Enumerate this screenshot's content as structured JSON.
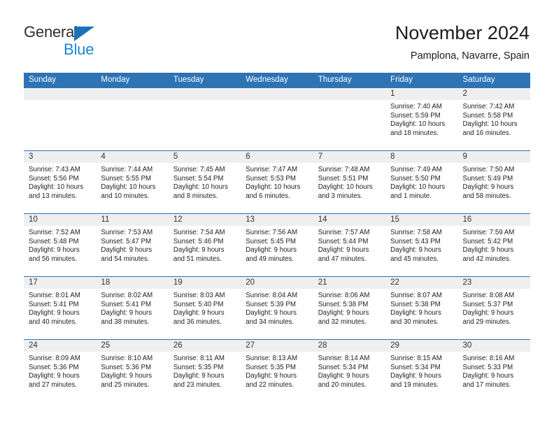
{
  "brand": {
    "name_part1": "General",
    "name_part2": "Blue",
    "logo_icon": "triangle-icon"
  },
  "header": {
    "title": "November 2024",
    "subtitle": "Pamplona, Navarre, Spain"
  },
  "colors": {
    "header_blue": "#2e73b4",
    "brand_blue": "#1b86d8",
    "logo_triangle_blue": "#1b72b8",
    "daynum_band": "#efefef",
    "text": "#1f1f1f"
  },
  "calendar": {
    "weekday_headers": [
      "Sunday",
      "Monday",
      "Tuesday",
      "Wednesday",
      "Thursday",
      "Friday",
      "Saturday"
    ],
    "weeks": [
      [
        {
          "day": "",
          "lines": []
        },
        {
          "day": "",
          "lines": []
        },
        {
          "day": "",
          "lines": []
        },
        {
          "day": "",
          "lines": []
        },
        {
          "day": "",
          "lines": []
        },
        {
          "day": "1",
          "lines": [
            "Sunrise: 7:40 AM",
            "Sunset: 5:59 PM",
            "Daylight: 10 hours",
            "and 18 minutes."
          ]
        },
        {
          "day": "2",
          "lines": [
            "Sunrise: 7:42 AM",
            "Sunset: 5:58 PM",
            "Daylight: 10 hours",
            "and 16 minutes."
          ]
        }
      ],
      [
        {
          "day": "3",
          "lines": [
            "Sunrise: 7:43 AM",
            "Sunset: 5:56 PM",
            "Daylight: 10 hours",
            "and 13 minutes."
          ]
        },
        {
          "day": "4",
          "lines": [
            "Sunrise: 7:44 AM",
            "Sunset: 5:55 PM",
            "Daylight: 10 hours",
            "and 10 minutes."
          ]
        },
        {
          "day": "5",
          "lines": [
            "Sunrise: 7:45 AM",
            "Sunset: 5:54 PM",
            "Daylight: 10 hours",
            "and 8 minutes."
          ]
        },
        {
          "day": "6",
          "lines": [
            "Sunrise: 7:47 AM",
            "Sunset: 5:53 PM",
            "Daylight: 10 hours",
            "and 6 minutes."
          ]
        },
        {
          "day": "7",
          "lines": [
            "Sunrise: 7:48 AM",
            "Sunset: 5:51 PM",
            "Daylight: 10 hours",
            "and 3 minutes."
          ]
        },
        {
          "day": "8",
          "lines": [
            "Sunrise: 7:49 AM",
            "Sunset: 5:50 PM",
            "Daylight: 10 hours",
            "and 1 minute."
          ]
        },
        {
          "day": "9",
          "lines": [
            "Sunrise: 7:50 AM",
            "Sunset: 5:49 PM",
            "Daylight: 9 hours",
            "and 58 minutes."
          ]
        }
      ],
      [
        {
          "day": "10",
          "lines": [
            "Sunrise: 7:52 AM",
            "Sunset: 5:48 PM",
            "Daylight: 9 hours",
            "and 56 minutes."
          ]
        },
        {
          "day": "11",
          "lines": [
            "Sunrise: 7:53 AM",
            "Sunset: 5:47 PM",
            "Daylight: 9 hours",
            "and 54 minutes."
          ]
        },
        {
          "day": "12",
          "lines": [
            "Sunrise: 7:54 AM",
            "Sunset: 5:46 PM",
            "Daylight: 9 hours",
            "and 51 minutes."
          ]
        },
        {
          "day": "13",
          "lines": [
            "Sunrise: 7:56 AM",
            "Sunset: 5:45 PM",
            "Daylight: 9 hours",
            "and 49 minutes."
          ]
        },
        {
          "day": "14",
          "lines": [
            "Sunrise: 7:57 AM",
            "Sunset: 5:44 PM",
            "Daylight: 9 hours",
            "and 47 minutes."
          ]
        },
        {
          "day": "15",
          "lines": [
            "Sunrise: 7:58 AM",
            "Sunset: 5:43 PM",
            "Daylight: 9 hours",
            "and 45 minutes."
          ]
        },
        {
          "day": "16",
          "lines": [
            "Sunrise: 7:59 AM",
            "Sunset: 5:42 PM",
            "Daylight: 9 hours",
            "and 42 minutes."
          ]
        }
      ],
      [
        {
          "day": "17",
          "lines": [
            "Sunrise: 8:01 AM",
            "Sunset: 5:41 PM",
            "Daylight: 9 hours",
            "and 40 minutes."
          ]
        },
        {
          "day": "18",
          "lines": [
            "Sunrise: 8:02 AM",
            "Sunset: 5:41 PM",
            "Daylight: 9 hours",
            "and 38 minutes."
          ]
        },
        {
          "day": "19",
          "lines": [
            "Sunrise: 8:03 AM",
            "Sunset: 5:40 PM",
            "Daylight: 9 hours",
            "and 36 minutes."
          ]
        },
        {
          "day": "20",
          "lines": [
            "Sunrise: 8:04 AM",
            "Sunset: 5:39 PM",
            "Daylight: 9 hours",
            "and 34 minutes."
          ]
        },
        {
          "day": "21",
          "lines": [
            "Sunrise: 8:06 AM",
            "Sunset: 5:38 PM",
            "Daylight: 9 hours",
            "and 32 minutes."
          ]
        },
        {
          "day": "22",
          "lines": [
            "Sunrise: 8:07 AM",
            "Sunset: 5:38 PM",
            "Daylight: 9 hours",
            "and 30 minutes."
          ]
        },
        {
          "day": "23",
          "lines": [
            "Sunrise: 8:08 AM",
            "Sunset: 5:37 PM",
            "Daylight: 9 hours",
            "and 29 minutes."
          ]
        }
      ],
      [
        {
          "day": "24",
          "lines": [
            "Sunrise: 8:09 AM",
            "Sunset: 5:36 PM",
            "Daylight: 9 hours",
            "and 27 minutes."
          ]
        },
        {
          "day": "25",
          "lines": [
            "Sunrise: 8:10 AM",
            "Sunset: 5:36 PM",
            "Daylight: 9 hours",
            "and 25 minutes."
          ]
        },
        {
          "day": "26",
          "lines": [
            "Sunrise: 8:11 AM",
            "Sunset: 5:35 PM",
            "Daylight: 9 hours",
            "and 23 minutes."
          ]
        },
        {
          "day": "27",
          "lines": [
            "Sunrise: 8:13 AM",
            "Sunset: 5:35 PM",
            "Daylight: 9 hours",
            "and 22 minutes."
          ]
        },
        {
          "day": "28",
          "lines": [
            "Sunrise: 8:14 AM",
            "Sunset: 5:34 PM",
            "Daylight: 9 hours",
            "and 20 minutes."
          ]
        },
        {
          "day": "29",
          "lines": [
            "Sunrise: 8:15 AM",
            "Sunset: 5:34 PM",
            "Daylight: 9 hours",
            "and 19 minutes."
          ]
        },
        {
          "day": "30",
          "lines": [
            "Sunrise: 8:16 AM",
            "Sunset: 5:33 PM",
            "Daylight: 9 hours",
            "and 17 minutes."
          ]
        }
      ]
    ]
  }
}
